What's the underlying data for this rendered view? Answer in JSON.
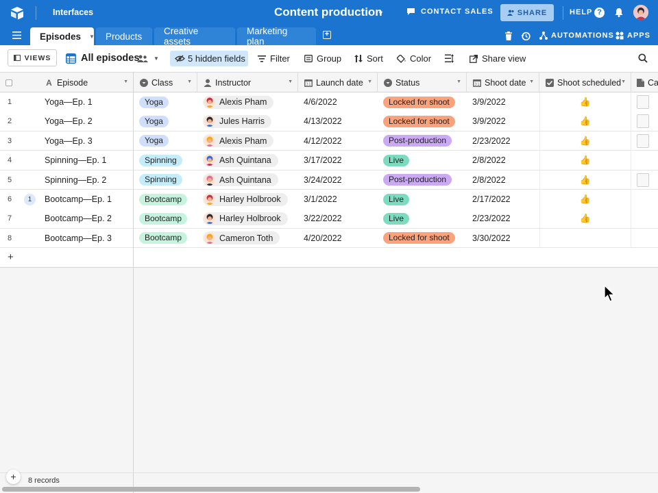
{
  "topbar": {
    "interfaces": "Interfaces",
    "base_title": "Content production",
    "contact_sales": "CONTACT SALES",
    "share": "SHARE",
    "help": "HELP"
  },
  "tabs": [
    {
      "label": "Episodes"
    },
    {
      "label": "Products"
    },
    {
      "label": "Creative assets"
    },
    {
      "label": "Marketing plan"
    }
  ],
  "tabbar_right": {
    "automations": "AUTOMATIONS",
    "apps": "APPS"
  },
  "viewbar": {
    "views": "VIEWS",
    "view_name": "All episodes",
    "hidden_fields": "5 hidden fields",
    "filter": "Filter",
    "group": "Group",
    "sort": "Sort",
    "color": "Color",
    "share_view": "Share view"
  },
  "columns": {
    "episode": "Episode",
    "class": "Class",
    "instructor": "Instructor",
    "launch_date": "Launch date",
    "status": "Status",
    "shoot_date": "Shoot date",
    "shoot_scheduled": "Shoot scheduled",
    "cal": "Cal"
  },
  "colors": {
    "brand": "#1b75d0",
    "yoga": "#cfdffb",
    "spinning": "#c4ecfb",
    "bootcamp": "#c6f3de",
    "locked": "#f9a27b",
    "post": "#cba9f5",
    "live": "#7ddcc0",
    "thumb": "#2fb12f"
  },
  "rows": [
    {
      "num": "1",
      "episode": "Yoga—Ep. 1",
      "class": "Yoga",
      "instructor": "Alexis Pham",
      "launch": "4/6/2022",
      "status": "Locked for shoot",
      "shoot": "3/9/2022",
      "scheduled": "👍"
    },
    {
      "num": "2",
      "episode": "Yoga—Ep. 2",
      "class": "Yoga",
      "instructor": "Jules Harris",
      "launch": "4/13/2022",
      "status": "Locked for shoot",
      "shoot": "3/9/2022",
      "scheduled": "👍"
    },
    {
      "num": "3",
      "episode": "Yoga—Ep. 3",
      "class": "Yoga",
      "instructor": "Alexis Pham",
      "launch": "4/12/2022",
      "status": "Post-production",
      "shoot": "2/23/2022",
      "scheduled": "👍"
    },
    {
      "num": "4",
      "episode": "Spinning—Ep. 1",
      "class": "Spinning",
      "instructor": "Ash Quintana",
      "launch": "3/17/2022",
      "status": "Live",
      "shoot": "2/8/2022",
      "scheduled": "👍"
    },
    {
      "num": "5",
      "episode": "Spinning—Ep. 2",
      "class": "Spinning",
      "instructor": "Ash Quintana",
      "launch": "3/24/2022",
      "status": "Post-production",
      "shoot": "2/8/2022",
      "scheduled": "👍"
    },
    {
      "num": "6",
      "comments": "1",
      "episode": "Bootcamp—Ep. 1",
      "class": "Bootcamp",
      "instructor": "Harley Holbrook",
      "launch": "3/1/2022",
      "status": "Live",
      "shoot": "2/17/2022",
      "scheduled": "👍"
    },
    {
      "num": "7",
      "episode": "Bootcamp—Ep. 2",
      "class": "Bootcamp",
      "instructor": "Harley Holbrook",
      "launch": "3/22/2022",
      "status": "Live",
      "shoot": "2/23/2022",
      "scheduled": "👍"
    },
    {
      "num": "8",
      "episode": "Bootcamp—Ep. 3",
      "class": "Bootcamp",
      "instructor": "Cameron Toth",
      "launch": "4/20/2022",
      "status": "Locked for shoot",
      "shoot": "3/30/2022",
      "scheduled": ""
    }
  ],
  "footer": {
    "records": "8 records"
  }
}
